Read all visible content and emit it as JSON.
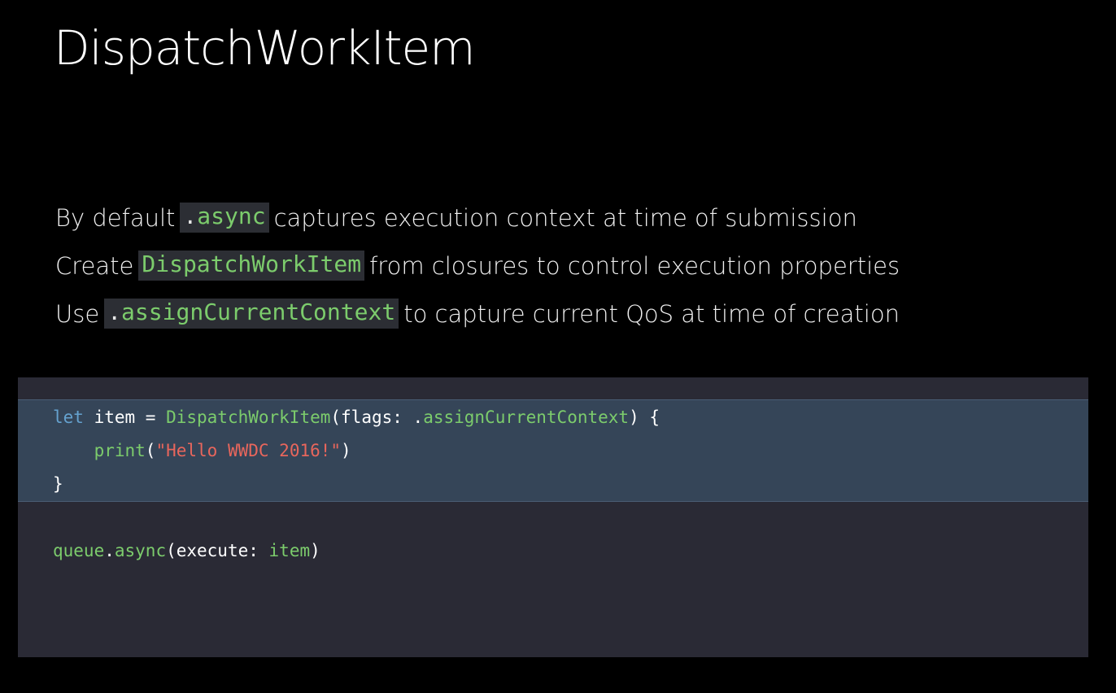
{
  "slide": {
    "title": "DispatchWorkItem"
  },
  "bullets": [
    {
      "before": "By default ",
      "code_dot": ".",
      "code": "async",
      "after": "captures execution context at time of submission"
    },
    {
      "before": "Create",
      "code_dot": "",
      "code": "DispatchWorkItem",
      "after": "from closures to control execution properties"
    },
    {
      "before": "Use",
      "code_dot": ".",
      "code": "assignCurrentContext",
      "after": "to capture current QoS at time of creation"
    }
  ],
  "code": {
    "line1": {
      "kw_let": "let",
      "var_item": " item = ",
      "type": "DispatchWorkItem",
      "open": "(flags: .",
      "member": "assignCurrentContext",
      "close": ") {"
    },
    "line2": {
      "indent": "    ",
      "fn": "print",
      "open": "(",
      "string": "\"Hello WWDC 2016!\"",
      "close": ")"
    },
    "line3": {
      "brace": "}"
    },
    "line4": {
      "receiver": "queue",
      "dot": ".",
      "method": "async",
      "open": "(execute: ",
      "arg": "item",
      "close": ")"
    }
  },
  "colors": {
    "background": "#000000",
    "code_panel": "#2a2a35",
    "highlight": "#354558",
    "keyword": "#65a2cf",
    "type": "#7ccc6c",
    "string": "#e8665c"
  }
}
